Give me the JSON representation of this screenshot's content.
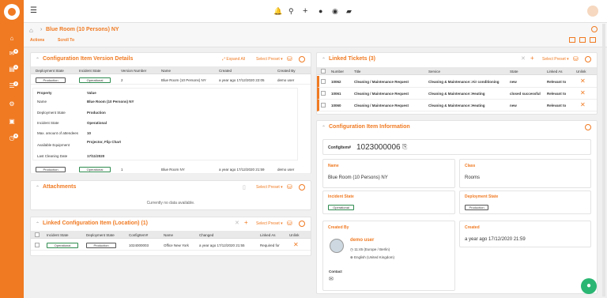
{
  "sidebar": {
    "badges": [
      "9",
      "1",
      "2",
      "9"
    ]
  },
  "breadcrumb": {
    "title": "Blue Room (10 Persons) NY",
    "actions": "Actions",
    "scroll_to": "Scroll To"
  },
  "version_panel": {
    "title": "Configuration Item Version Details",
    "expand_all": "Expand All",
    "select_preset": "Select Preset",
    "headers": [
      "Deployment State",
      "Incident State",
      "Version Number",
      "Name",
      "Created",
      "Created By"
    ],
    "row1": {
      "deployment": "Production",
      "incident": "Operational",
      "version": "2",
      "name": "Blue Room (10 Persons) NY",
      "created": "a year ago 17/12/2020 22:05",
      "created_by": "demo user"
    },
    "detail_headers": [
      "Property",
      "Value"
    ],
    "details": [
      {
        "p": "Name",
        "v": "Blue Room (10 Persons) NY"
      },
      {
        "p": "Deployment State",
        "v": "Production"
      },
      {
        "p": "Incident State",
        "v": "Operational"
      },
      {
        "p": "Max. amount of attendees",
        "v": "10"
      },
      {
        "p": "Available Equipment",
        "v": "Projector, Flip Chart"
      },
      {
        "p": "Last Cleaning Date",
        "v": "17/11/2020"
      }
    ],
    "row2": {
      "deployment": "Production",
      "incident": "Operational",
      "version": "1",
      "name": "Blue Room NY",
      "created": "a year ago 17/12/2020 21:59",
      "created_by": "demo user"
    }
  },
  "attachments": {
    "title": "Attachments",
    "select_preset": "Select Preset",
    "empty": "Currently no data available."
  },
  "linked_ci": {
    "title": "Linked Configuration Item (Location) (1)",
    "select_preset": "Select Preset",
    "headers": [
      "Incident State",
      "Deployment State",
      "ConfigItem#",
      "Name",
      "Changed",
      "Linked As",
      "Unlink"
    ],
    "row": {
      "incident": "Operational",
      "deployment": "Production",
      "number": "1024000003",
      "name": "Office New York",
      "changed": "a year ago 17/12/2020 21:55",
      "linked_as": "Required for"
    }
  },
  "linked_tickets": {
    "title": "Linked Tickets (3)",
    "select_preset": "Select Preset",
    "headers": [
      "Number",
      "Title",
      "Service",
      "State",
      "Linked As",
      "Unlink"
    ],
    "rows": [
      {
        "number": "10062",
        "title": "Cleaning / Maintenance Request",
        "service": "Cleaning & Maintenance::Air conditioning",
        "state": "new",
        "linked_as": "Relevant to"
      },
      {
        "number": "10061",
        "title": "Cleaning / Maintenance Request",
        "service": "Cleaning & Maintenance::Heating",
        "state": "closed successful",
        "linked_as": "Relevant to"
      },
      {
        "number": "10060",
        "title": "Cleaning / Maintenance Request",
        "service": "Cleaning & Maintenance::Heating",
        "state": "new",
        "linked_as": "Relevant to"
      }
    ]
  },
  "ci_info": {
    "title": "Configuration Item Information",
    "configitem_label": "ConfigItem#",
    "configitem_value": "1023000006",
    "name_label": "Name",
    "name_value": "Blue Room (10 Persons) NY",
    "class_label": "Class",
    "class_value": "Rooms",
    "incident_label": "Incident State",
    "incident_value": "Operational",
    "deployment_label": "Deployment State",
    "deployment_value": "Production",
    "created_by_label": "Created By",
    "user_name": "demo user",
    "user_time": "11:45 (Europe / Berlin)",
    "user_lang": "English (United Kingdom)",
    "contact_label": "Contact",
    "created_label": "Created",
    "created_value": "a year ago 17/12/2020 21:59"
  }
}
